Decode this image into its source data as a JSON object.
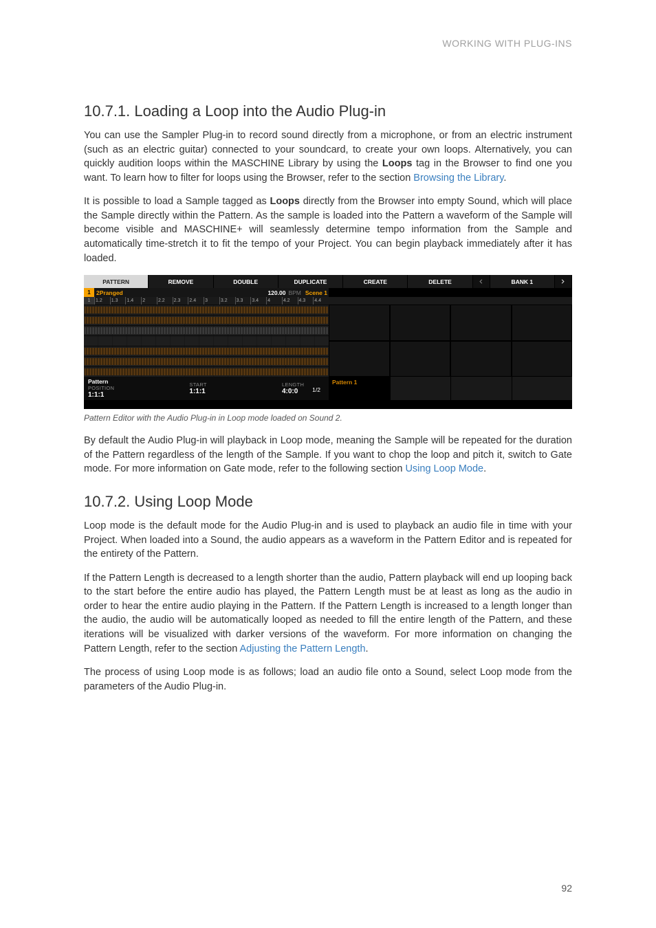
{
  "header": "WORKING WITH PLUG-INS",
  "page_number": "92",
  "section1": {
    "title": "10.7.1. Loading a Loop into the Audio Plug-in",
    "p1a": "You can use the Sampler Plug-in to record sound directly from a microphone, or from an electric instrument (such as an electric guitar) connected to your soundcard, to create your own loops. Alternatively, you can quickly audition loops within the MASCHINE Library by using the ",
    "p1bold": "Loops",
    "p1b": " tag in the Browser to find one you want. To learn how to filter for loops using the Browser, refer to the section ",
    "p1link": "Browsing the Library",
    "p1c": ".",
    "p2a": "It is possible to load a Sample tagged as ",
    "p2bold": "Loops",
    "p2b": " directly from the Browser into empty Sound, which will place the Sample directly within the Pattern. As the sample is loaded into the Pattern a waveform of the Sample will become visible and MASCHINE+ will seamlessly determine tempo information from the Sample and automatically time-stretch it to fit the tempo of your Project. You can begin playback immediately after it has loaded."
  },
  "figure": {
    "top_buttons": [
      "PATTERN",
      "REMOVE",
      "DOUBLE",
      "DUPLICATE",
      "CREATE",
      "DELETE"
    ],
    "bank_label": "BANK 1",
    "sound_num": "1",
    "sound_name": "2Pranged",
    "bpm_value": "120.00",
    "bpm_unit": "BPM",
    "scene": "Scene 1",
    "timeline_padnum": "1",
    "timeline_ticks": [
      "1.2",
      "1.3",
      "1.4",
      "2",
      "2.2",
      "2.3",
      "2.4",
      "3",
      "3.2",
      "3.3",
      "3.4",
      "4",
      "4.2",
      "4.3",
      "4.4"
    ],
    "bottom": {
      "title": "Pattern",
      "page": "1/2",
      "position_label": "POSITION",
      "position_value": "1:1:1",
      "start_label": "START",
      "start_value": "1:1:1",
      "length_label": "LENGTH",
      "length_value": "4:0:0",
      "pattern_cell": "Pattern 1"
    }
  },
  "caption": "Pattern Editor with the Audio Plug-in in Loop mode loaded on Sound 2.",
  "after1": {
    "p1a": "By default the Audio Plug-in will playback in Loop mode, meaning the Sample will be repeated for the duration of the Pattern regardless of the length of the Sample. If you want to chop the loop and pitch it, switch to Gate mode. For more information on Gate mode, refer to the following section ",
    "p1link": "Using Loop Mode",
    "p1b": "."
  },
  "section2": {
    "title": "10.7.2. Using Loop Mode",
    "p1": "Loop mode is the default mode for the Audio Plug-in and is used to playback an audio file in time with your Project. When loaded into a Sound, the audio appears as a waveform in the Pattern Editor and is repeated for the entirety of the Pattern.",
    "p2a": "If the Pattern Length is decreased to a length shorter than the audio, Pattern playback will end up looping back to the start before the entire audio has played, the Pattern Length must be at least as long as the audio in order to hear the entire audio playing in the Pattern. If the Pattern Length is increased to a length longer than the audio, the audio will be automatically looped as needed to fill the entire length of the Pattern, and these iterations will be visualized with darker versions of the waveform. For more information on changing the Pattern Length, refer to the section ",
    "p2link": "Adjusting the Pattern Length",
    "p2b": ".",
    "p3": "The process of using Loop mode is as follows; load an audio file onto a Sound, select Loop mode from the parameters of the Audio Plug-in."
  }
}
